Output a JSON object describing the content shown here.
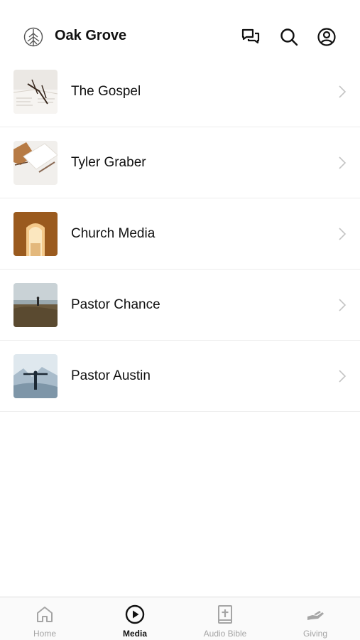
{
  "header": {
    "title": "Oak Grove",
    "logo_icon": "tree-logo-icon",
    "icons": [
      "chat-bubbles-icon",
      "search-icon",
      "profile-icon"
    ]
  },
  "list": {
    "items": [
      {
        "label": "The Gospel",
        "thumb": "open-book-glasses"
      },
      {
        "label": "Tyler Graber",
        "thumb": "notebook-pen"
      },
      {
        "label": "Church Media",
        "thumb": "empty-tomb"
      },
      {
        "label": "Pastor Chance",
        "thumb": "person-on-hill"
      },
      {
        "label": "Pastor Austin",
        "thumb": "person-arms-outstretched"
      }
    ]
  },
  "tabbar": {
    "active": "Media",
    "tabs": [
      {
        "label": "Home",
        "icon": "home-icon"
      },
      {
        "label": "Media",
        "icon": "play-circle-icon"
      },
      {
        "label": "Audio Bible",
        "icon": "bible-icon"
      },
      {
        "label": "Giving",
        "icon": "giving-hand-icon"
      }
    ]
  },
  "colors": {
    "text": "#111111",
    "inactive_tab": "#a5a5a5",
    "divider": "#ececec",
    "chevron": "#c4c4c4"
  }
}
